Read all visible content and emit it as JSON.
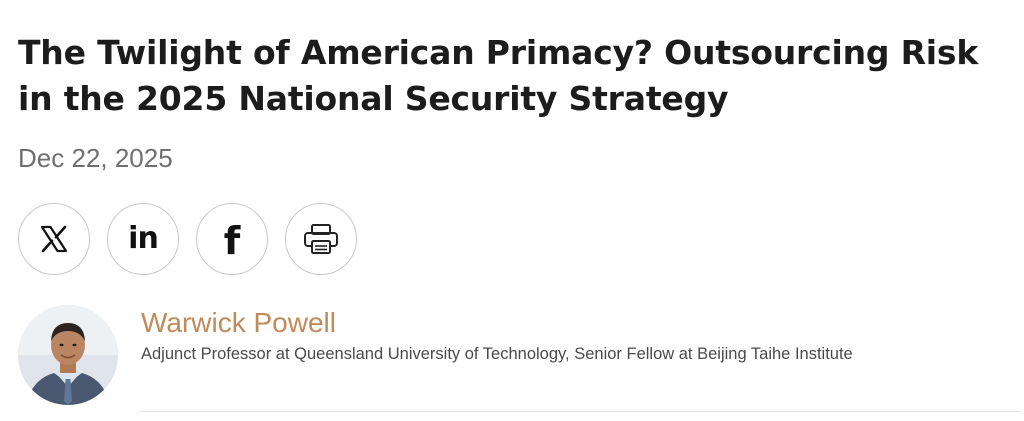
{
  "article": {
    "title": "The Twilight of American Primacy? Outsourcing Risk in the 2025 National Security Strategy",
    "date": "Dec 22, 2025"
  },
  "share": {
    "buttons": [
      {
        "name": "x",
        "icon": "x-logo-icon"
      },
      {
        "name": "linkedin",
        "icon": "linkedin-icon",
        "glyph": "in"
      },
      {
        "name": "facebook",
        "icon": "facebook-icon",
        "glyph": "f"
      },
      {
        "name": "print",
        "icon": "printer-icon"
      }
    ]
  },
  "author": {
    "name": "Warwick Powell",
    "bio": "Adjunct Professor at Queensland University of Technology, Senior Fellow at Beijing Taihe Institute",
    "name_color": "#c08a5b"
  }
}
